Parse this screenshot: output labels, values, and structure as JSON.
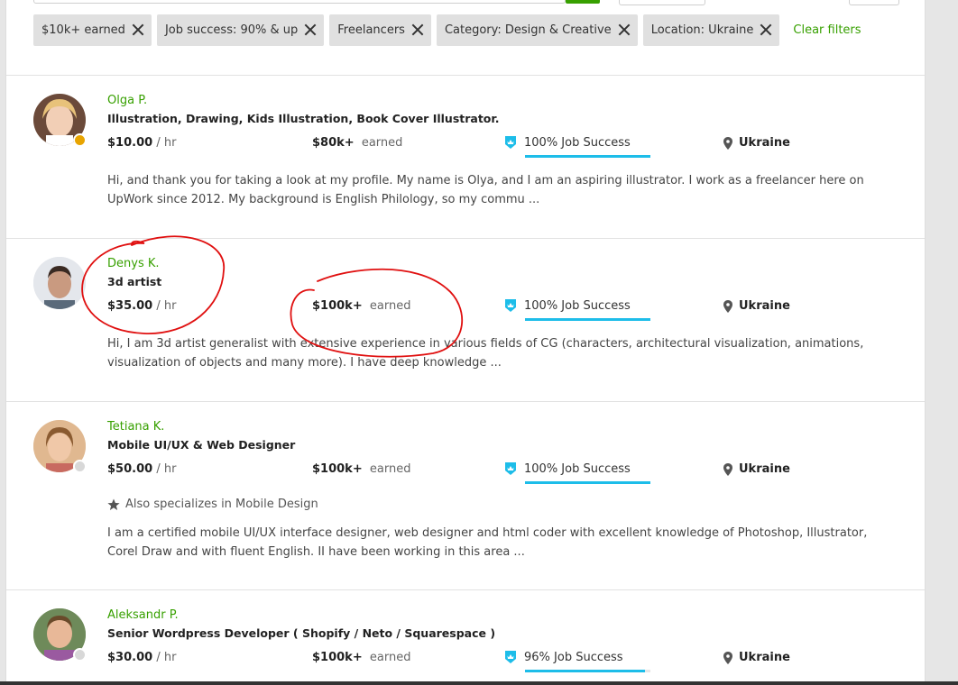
{
  "filters": [
    {
      "label": "$10k+ earned"
    },
    {
      "label": "Job success: 90% & up"
    },
    {
      "label": "Freelancers"
    },
    {
      "label": "Category: Design & Creative"
    },
    {
      "label": "Location: Ukraine"
    }
  ],
  "clear_filters": "Clear filters",
  "colors": {
    "accent": "#37a000",
    "job_success": "#1dbde9",
    "annotation": "#e01010"
  },
  "freelancers": [
    {
      "name": "Olga P.",
      "title": "Illustration, Drawing, Kids Illustration, Book Cover Illustrator.",
      "rate": "$10.00",
      "rate_unit": "/ hr",
      "earned": "$80k+",
      "earned_label": "earned",
      "job_success": "100% Job Success",
      "job_success_value": 1.0,
      "location": "Ukraine",
      "status": "online",
      "description": "Hi, and thank you for taking a look at my profile. My name is Olya, and I am an aspiring illustrator. I work as a freelancer here on UpWork since 2012. My background is English Philology, so my commu ..."
    },
    {
      "name": "Denys K.",
      "title": "3d artist",
      "rate": "$35.00",
      "rate_unit": "/ hr",
      "earned": "$100k+",
      "earned_label": "earned",
      "job_success": "100% Job Success",
      "job_success_value": 1.0,
      "location": "Ukraine",
      "status": "none",
      "description": "Hi, I am 3d artist generalist with extensive experience in various fields of CG (characters, architectural visualization, animations, visualization of objects and many more). I have deep knowledge ..."
    },
    {
      "name": "Tetiana K.",
      "title": "Mobile UI/UX & Web Designer",
      "rate": "$50.00",
      "rate_unit": "/ hr",
      "earned": "$100k+",
      "earned_label": "earned",
      "job_success": "100% Job Success",
      "job_success_value": 1.0,
      "location": "Ukraine",
      "status": "offline",
      "also": "Also specializes in Mobile Design",
      "description": "I am a certified mobile UI/UX interface designer, web designer and html coder with excellent knowledge of Photoshop, Illustrator, Corel Draw and with fluent English. II have been working in this area ..."
    },
    {
      "name": "Aleksandr P.",
      "title": "Senior Wordpress Developer ( Shopify / Neto / Squarespace )",
      "rate": "$30.00",
      "rate_unit": "/ hr",
      "earned": "$100k+",
      "earned_label": "earned",
      "job_success": "96% Job Success",
      "job_success_value": 0.96,
      "location": "Ukraine",
      "status": "offline"
    }
  ]
}
